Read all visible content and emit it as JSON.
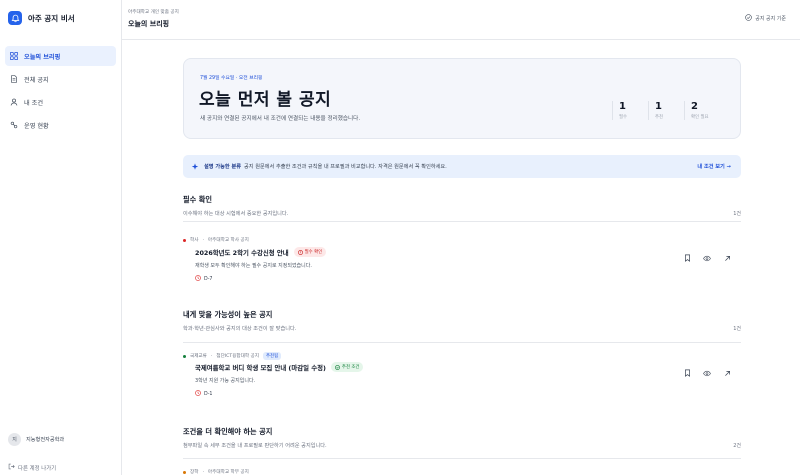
{
  "app": {
    "name": "아주 공지 비서"
  },
  "sidebar": {
    "items": [
      {
        "label": "오늘의 브리핑",
        "active": true
      },
      {
        "label": "전체 공지",
        "active": false
      },
      {
        "label": "내 조건",
        "active": false
      },
      {
        "label": "운영 현황",
        "active": false
      }
    ],
    "user": {
      "avatar": "지",
      "name": "지능형전자공학과",
      "sub": ""
    },
    "logout_label": "다른 계정 나가기"
  },
  "topbar": {
    "breadcrumb": "아주대학교 개인 맞춤 공지",
    "title": "오늘의 브리핑",
    "right_label": "공지 공지 기준"
  },
  "hero": {
    "eyebrow": "7월 29일 수요일 · 오전 브리핑",
    "title": "오늘 먼저 볼 공지",
    "desc": "새 공지와 연결된 공지에서 내 조건에 연결되는 내용을 정리했습니다.",
    "stats": [
      {
        "value": "1",
        "label": "필수"
      },
      {
        "value": "1",
        "label": "추천"
      },
      {
        "value": "2",
        "label": "확인 필요"
      }
    ]
  },
  "banner": {
    "strong": "설명 가능한 분류",
    "text": "공지 원문에서 추출한 조건과 규칙을 내 프로필과 비교합니다. 자격은 원문에서 꼭 확인하세요.",
    "link": "내 조건 보기 →"
  },
  "sections": [
    {
      "title": "필수 확인",
      "desc": "이수해야 하는 대상 시험에서 중요한 공지입니다.",
      "count": "1건",
      "cards": [
        {
          "dot_color": "#dc2626",
          "meta_source": "학사",
          "meta_org": "아주대학교 학사 공지",
          "meta_tag": "",
          "title": "2026학년도 2학기 수강신청 안내",
          "badge": "필수 확인",
          "badge_tone": "red",
          "desc": "재학생 모두 확인해야 하는 필수 공지로 지정되었습니다.",
          "due": "D-7"
        }
      ]
    },
    {
      "title": "내게 맞을 가능성이 높은 공지",
      "desc": "학과·학년·관심사와 공지의 대상 조건이 잘 맞습니다.",
      "count": "1건",
      "cards": [
        {
          "dot_color": "#15803d",
          "meta_source": "국제교류",
          "meta_org": "첨단ICT융합대학 공지",
          "meta_tag": "추천됨",
          "title": "국제여름학교 버디 학생 모집 안내 (마감일 수정)",
          "badge": "추천 조건",
          "badge_tone": "green",
          "desc": "3학년 지원 가능 공지입니다.",
          "due": "D-1"
        }
      ]
    },
    {
      "title": "조건을 더 확인해야 하는 공지",
      "desc": "첨부파일 속 세부 조건을 내 프로필로 판단하기 어려운 공지입니다.",
      "count": "2건",
      "cards": [
        {
          "dot_color": "#d97706",
          "meta_source": "장학",
          "meta_org": "아주대학교 학부 공지",
          "meta_tag": "",
          "title": "",
          "badge": "",
          "badge_tone": "",
          "desc": "",
          "due": ""
        }
      ]
    }
  ],
  "icons": {
    "brand": "bell-icon",
    "nav": [
      "grid-icon",
      "document-icon",
      "user-icon",
      "chart-icon"
    ],
    "actions": [
      "bookmark-icon",
      "eye-icon",
      "external-link-icon"
    ],
    "banner": "sparkle-icon",
    "due": "clock-icon",
    "logout": "logout-icon",
    "top_right": "check-circle-icon"
  },
  "colors": {
    "accent": "#2563eb",
    "hero_bg": "#f4f6fb",
    "banner_bg": "#e8f0fd"
  }
}
